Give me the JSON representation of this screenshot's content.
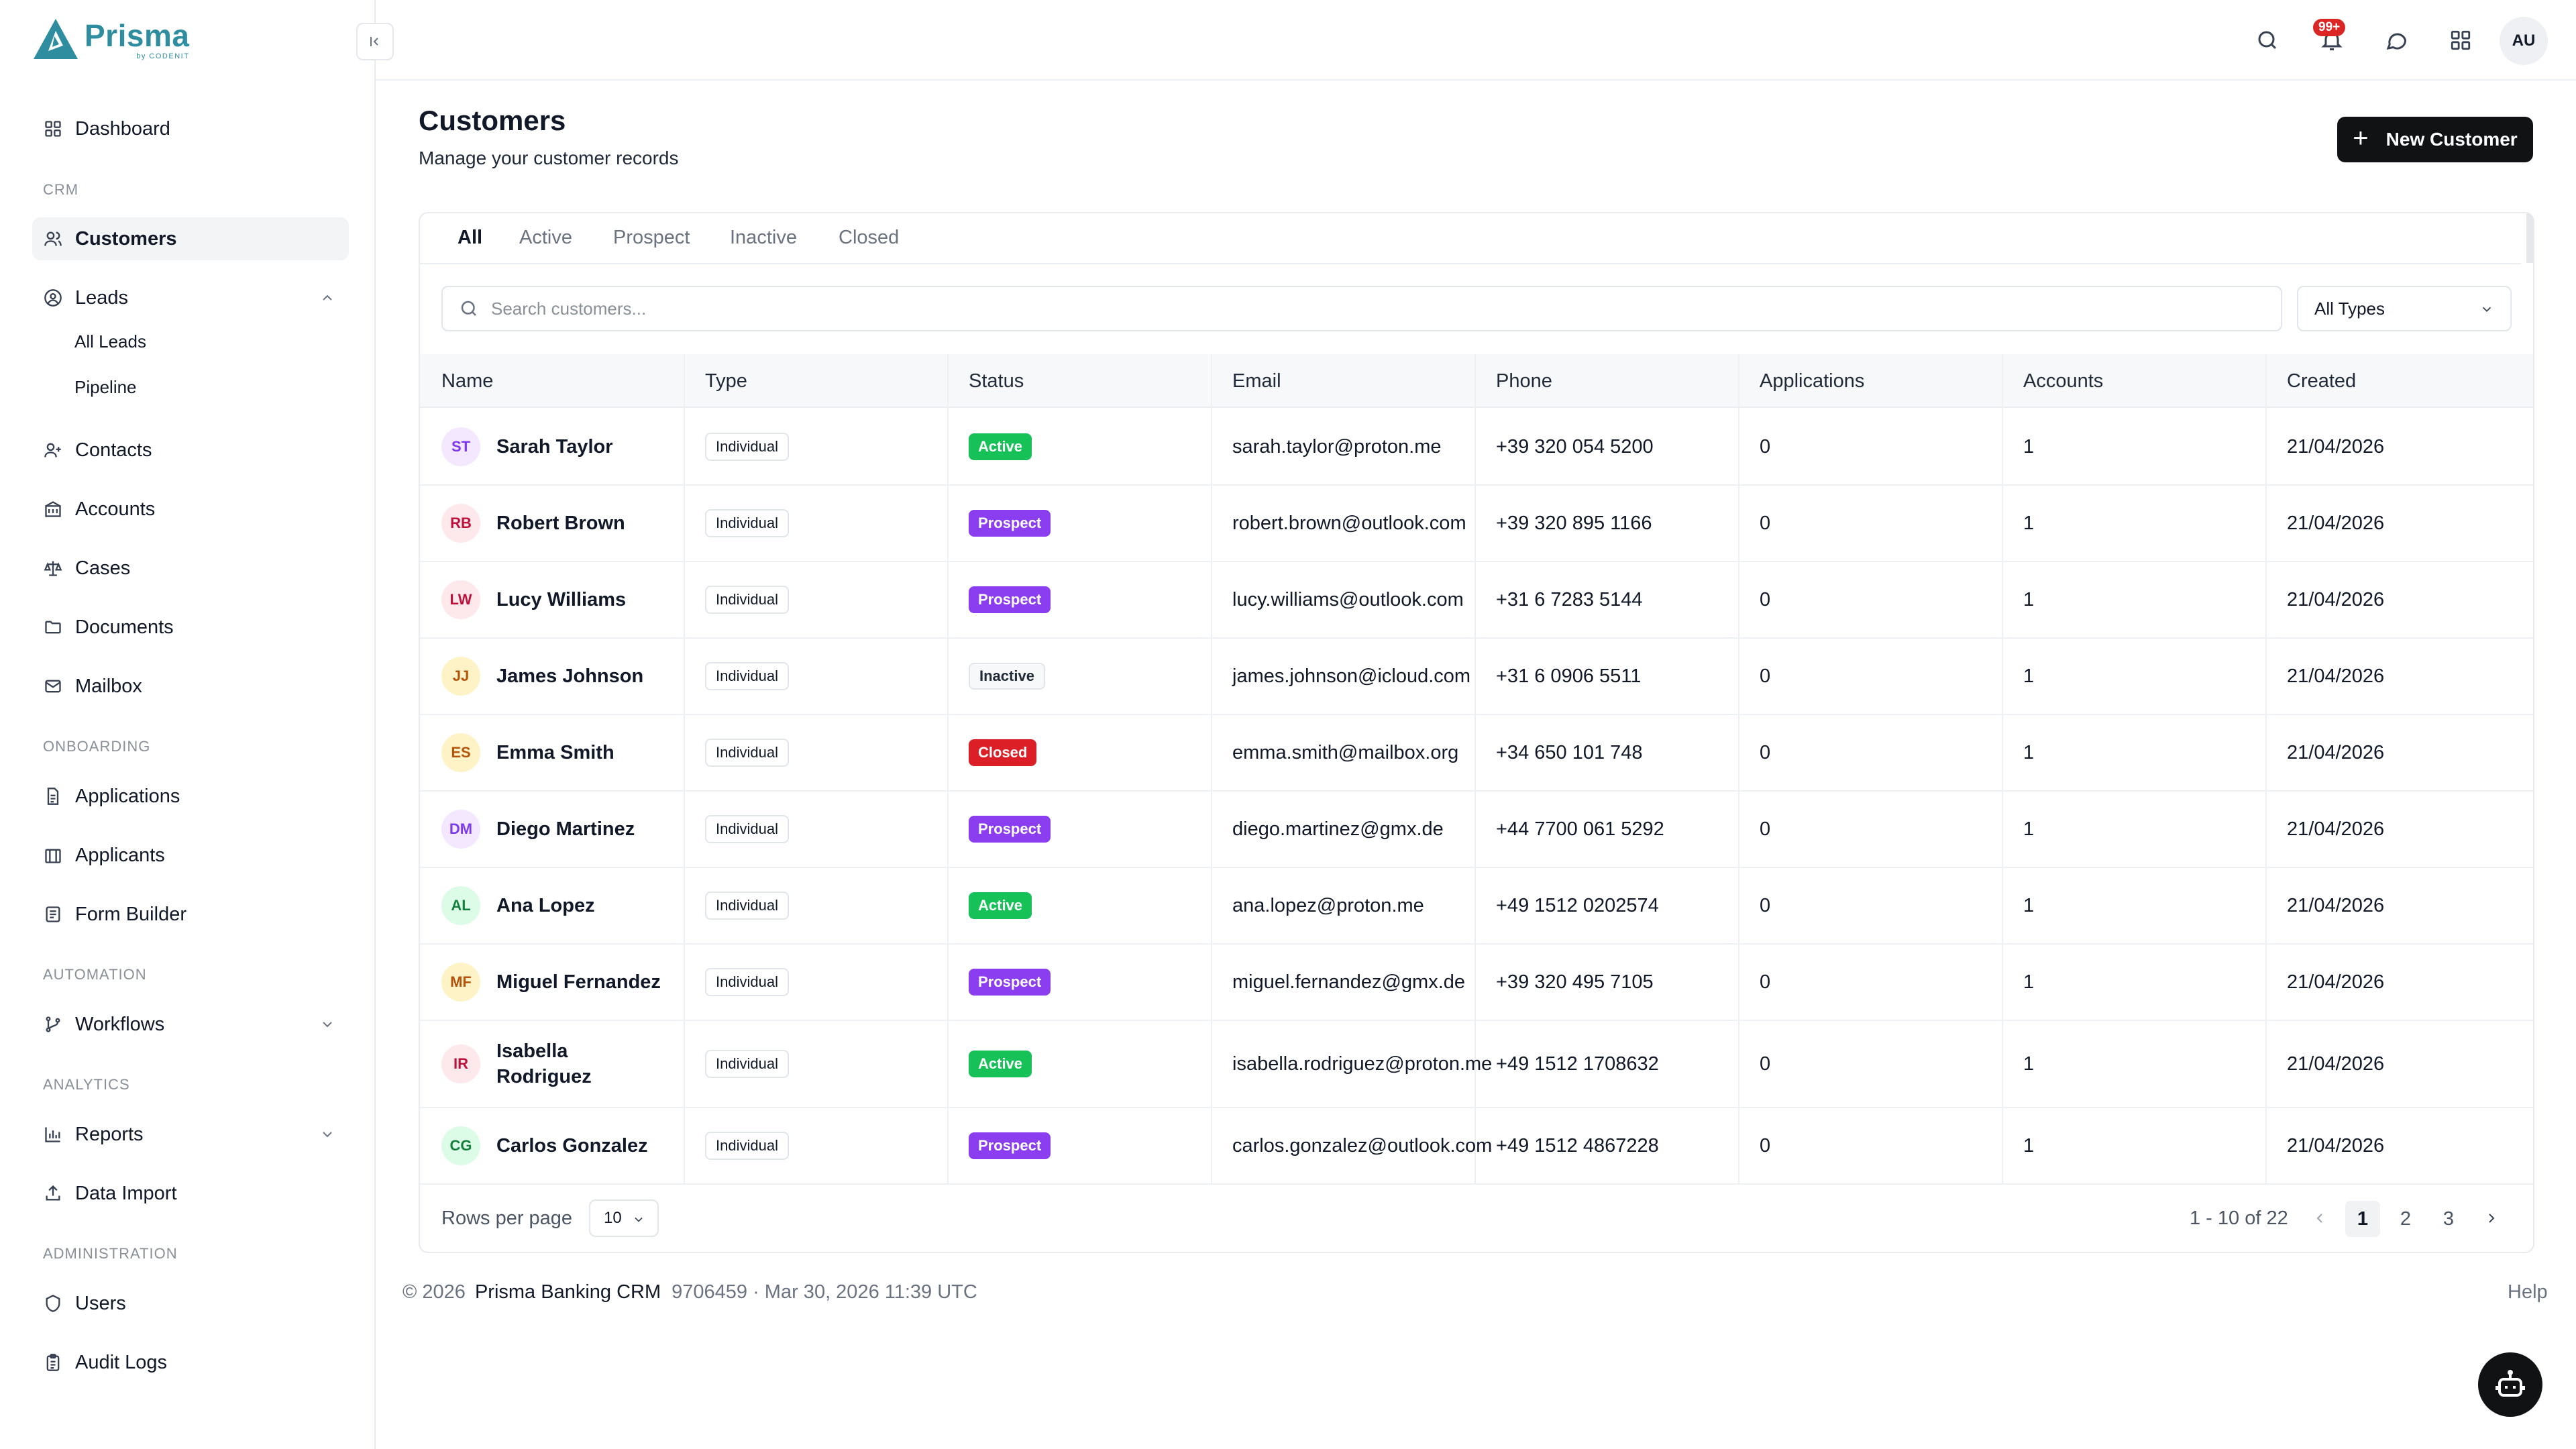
{
  "app": {
    "logo_text": "Prisma",
    "logo_subtext": "by CODENIT"
  },
  "sidebar": {
    "dashboard": "Dashboard",
    "sections": {
      "crm": "CRM",
      "onboarding": "ONBOARDING",
      "automation": "AUTOMATION",
      "analytics": "ANALYTICS",
      "administration": "ADMINISTRATION"
    },
    "items": {
      "customers": "Customers",
      "leads": "Leads",
      "all_leads": "All Leads",
      "pipeline": "Pipeline",
      "contacts": "Contacts",
      "accounts": "Accounts",
      "cases": "Cases",
      "documents": "Documents",
      "mailbox": "Mailbox",
      "applications": "Applications",
      "applicants": "Applicants",
      "form_builder": "Form Builder",
      "workflows": "Workflows",
      "reports": "Reports",
      "data_import": "Data Import",
      "users": "Users",
      "audit_logs": "Audit Logs"
    },
    "active_item": "Customers"
  },
  "topbar": {
    "notification_count": "99+",
    "user_initials": "AU"
  },
  "page": {
    "title": "Customers",
    "subtitle": "Manage your customer records",
    "new_button": "New Customer"
  },
  "tabs": [
    "All",
    "Active",
    "Prospect",
    "Inactive",
    "Closed"
  ],
  "active_tab": "All",
  "search": {
    "placeholder": "Search customers...",
    "value": ""
  },
  "type_filter": "All Types",
  "table": {
    "columns": [
      "Name",
      "Type",
      "Status",
      "Email",
      "Phone",
      "Applications",
      "Accounts",
      "Created"
    ],
    "rows": [
      {
        "initials": "ST",
        "name": "Sarah Taylor",
        "type": "Individual",
        "status": "Active",
        "email": "sarah.taylor@proton.me",
        "phone": "+39 320 054 5200",
        "applications": "0",
        "accounts": "1",
        "created": "21/04/2026"
      },
      {
        "initials": "RB",
        "name": "Robert Brown",
        "type": "Individual",
        "status": "Prospect",
        "email": "robert.brown@outlook.com",
        "phone": "+39 320 895 1166",
        "applications": "0",
        "accounts": "1",
        "created": "21/04/2026"
      },
      {
        "initials": "LW",
        "name": "Lucy Williams",
        "type": "Individual",
        "status": "Prospect",
        "email": "lucy.williams@outlook.com",
        "phone": "+31 6 7283 5144",
        "applications": "0",
        "accounts": "1",
        "created": "21/04/2026"
      },
      {
        "initials": "JJ",
        "name": "James Johnson",
        "type": "Individual",
        "status": "Inactive",
        "email": "james.johnson@icloud.com",
        "phone": "+31 6 0906 5511",
        "applications": "0",
        "accounts": "1",
        "created": "21/04/2026"
      },
      {
        "initials": "ES",
        "name": "Emma Smith",
        "type": "Individual",
        "status": "Closed",
        "email": "emma.smith@mailbox.org",
        "phone": "+34 650 101 748",
        "applications": "0",
        "accounts": "1",
        "created": "21/04/2026"
      },
      {
        "initials": "DM",
        "name": "Diego Martinez",
        "type": "Individual",
        "status": "Prospect",
        "email": "diego.martinez@gmx.de",
        "phone": "+44 7700 061 5292",
        "applications": "0",
        "accounts": "1",
        "created": "21/04/2026"
      },
      {
        "initials": "AL",
        "name": "Ana Lopez",
        "type": "Individual",
        "status": "Active",
        "email": "ana.lopez@proton.me",
        "phone": "+49 1512 0202574",
        "applications": "0",
        "accounts": "1",
        "created": "21/04/2026"
      },
      {
        "initials": "MF",
        "name": "Miguel Fernandez",
        "type": "Individual",
        "status": "Prospect",
        "email": "miguel.fernandez@gmx.de",
        "phone": "+39 320 495 7105",
        "applications": "0",
        "accounts": "1",
        "created": "21/04/2026"
      },
      {
        "initials": "IR",
        "name": "Isabella Rodriguez",
        "type": "Individual",
        "status": "Active",
        "email": "isabella.rodriguez@proton.me",
        "phone": "+49 1512 1708632",
        "applications": "0",
        "accounts": "1",
        "created": "21/04/2026"
      },
      {
        "initials": "CG",
        "name": "Carlos Gonzalez",
        "type": "Individual",
        "status": "Prospect",
        "email": "carlos.gonzalez@outlook.com",
        "phone": "+49 1512 4867228",
        "applications": "0",
        "accounts": "1",
        "created": "21/04/2026"
      }
    ]
  },
  "pagination": {
    "rows_per_page_label": "Rows per page",
    "rows_per_page": "10",
    "range": "1 - 10 of 22",
    "pages": [
      "1",
      "2",
      "3"
    ],
    "current_page": "1"
  },
  "footer": {
    "copyright": "© 2026",
    "brand": "Prisma Banking CRM",
    "build": "9706459 · Mar 30, 2026 11:39 UTC",
    "help": "Help"
  },
  "colors": {
    "logo": "#2e8ea0",
    "status_active": "#16c257",
    "status_prospect": "#8b3df0",
    "status_closed": "#dc1f26",
    "primary_button": "#111214"
  },
  "avatar_colors": {
    "ST": {
      "bg": "#f3e8ff",
      "fg": "#7c3aed"
    },
    "RB": {
      "bg": "#fde8ec",
      "fg": "#be123c"
    },
    "LW": {
      "bg": "#fde8ec",
      "fg": "#be123c"
    },
    "JJ": {
      "bg": "#fef3c7",
      "fg": "#b45309"
    },
    "ES": {
      "bg": "#fef3c7",
      "fg": "#b45309"
    },
    "DM": {
      "bg": "#f3e8ff",
      "fg": "#7c3aed"
    },
    "AL": {
      "bg": "#dcfce7",
      "fg": "#15803d"
    },
    "MF": {
      "bg": "#fef3c7",
      "fg": "#b45309"
    },
    "IR": {
      "bg": "#fde8ec",
      "fg": "#be123c"
    },
    "CG": {
      "bg": "#dcfce7",
      "fg": "#15803d"
    }
  }
}
